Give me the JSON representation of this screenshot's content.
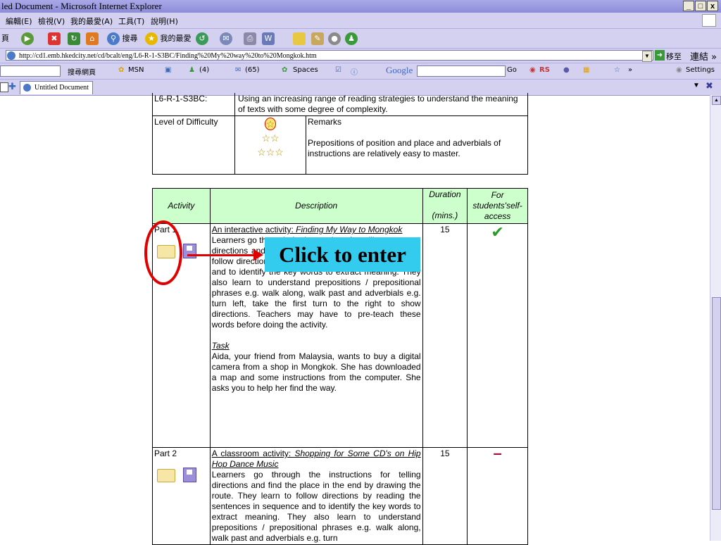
{
  "window": {
    "title": "led Document - Microsoft Internet Explorer",
    "min": "_",
    "max": "□",
    "close": "x"
  },
  "menu": [
    "編輯(E)",
    "檢視(V)",
    "我的最愛(A)",
    "工具(T)",
    "說明(H)"
  ],
  "toolbar": {
    "page_label": "頁",
    "search_label": "搜尋",
    "favorites_label": "我的最愛"
  },
  "address": {
    "url": "http://cd1.emb.hkedcity.net/cd/bcalt/eng/L6-R-1-S3BC/Finding%20My%20way%20to%20Mongkok.htm",
    "go_label": "移至",
    "links_label": "連結 »"
  },
  "links": {
    "search_web": "搜尋網頁",
    "msn": "MSN",
    "count_a": "(4)",
    "count_b": "(65)",
    "spaces": "Spaces",
    "google": "Google",
    "go": "Go",
    "rs": "RS",
    "more": "»",
    "settings": "Settings"
  },
  "tab": {
    "label": "Untitled Document"
  },
  "info_table": {
    "code": "L6-R-1-S3BC:",
    "objective": "Using an increasing range of reading strategies to understand the meaning of texts with some degree of complexity.",
    "level_label": "Level of Difficulty",
    "stars": [
      "☆",
      "☆☆",
      "☆☆☆"
    ],
    "remarks_label": "Remarks",
    "remarks": "Prepositions of position and place and adverbials of instructions are relatively easy to master."
  },
  "activity_table": {
    "headers": {
      "activity": "Activity",
      "description": "Description",
      "duration_line1": "Duration",
      "duration_line2": "(mins.)",
      "access": "For students'self-access"
    },
    "part1": {
      "label": "Part 1",
      "title_plain": "An interactive activity: ",
      "title_italic": "Finding My Way to Mongkok",
      "para_a": "Learners go through the instructions for telling",
      "para_b": "directions and find the place in the end. They learn",
      "para_c": "to follow directions by reading the sentences in sequence and to identify the key words to extract meaning. They also learn to understand prepositions / prepositional phrases e.g. walk along, walk past and adverbials e.g. turn left, take the first turn to the right to show directions. Teachers may have to pre-teach these words before doing the activity.",
      "task_label": "Task",
      "task": "Aida, your friend from Malaysia, wants to buy a digital camera from a shop in Mongkok. She has downloaded a map and some instructions from the computer. She asks you to help her find the way.",
      "duration": "15",
      "access": "✔"
    },
    "part2": {
      "label": "Part 2",
      "title_plain": "A classroom activity: ",
      "title_italic": "Shopping for Some CD's on Hip Hop Dance Music",
      "desc": "Learners go through the instructions for telling directions and find the place in the end by drawing the route. They learn to follow directions by reading the sentences in sequence and to identify the key words to extract meaning. They also learn to understand prepositions / prepositional phrases e.g. walk along, walk past and adverbials e.g. turn",
      "duration": "15",
      "access": "–"
    }
  },
  "callout": {
    "text": "Click to enter"
  },
  "colors": {
    "header_bg": "#ccffcc",
    "callout_bg": "#33ccee",
    "annot_red": "#e00000",
    "check_green": "#2a9a2a"
  }
}
